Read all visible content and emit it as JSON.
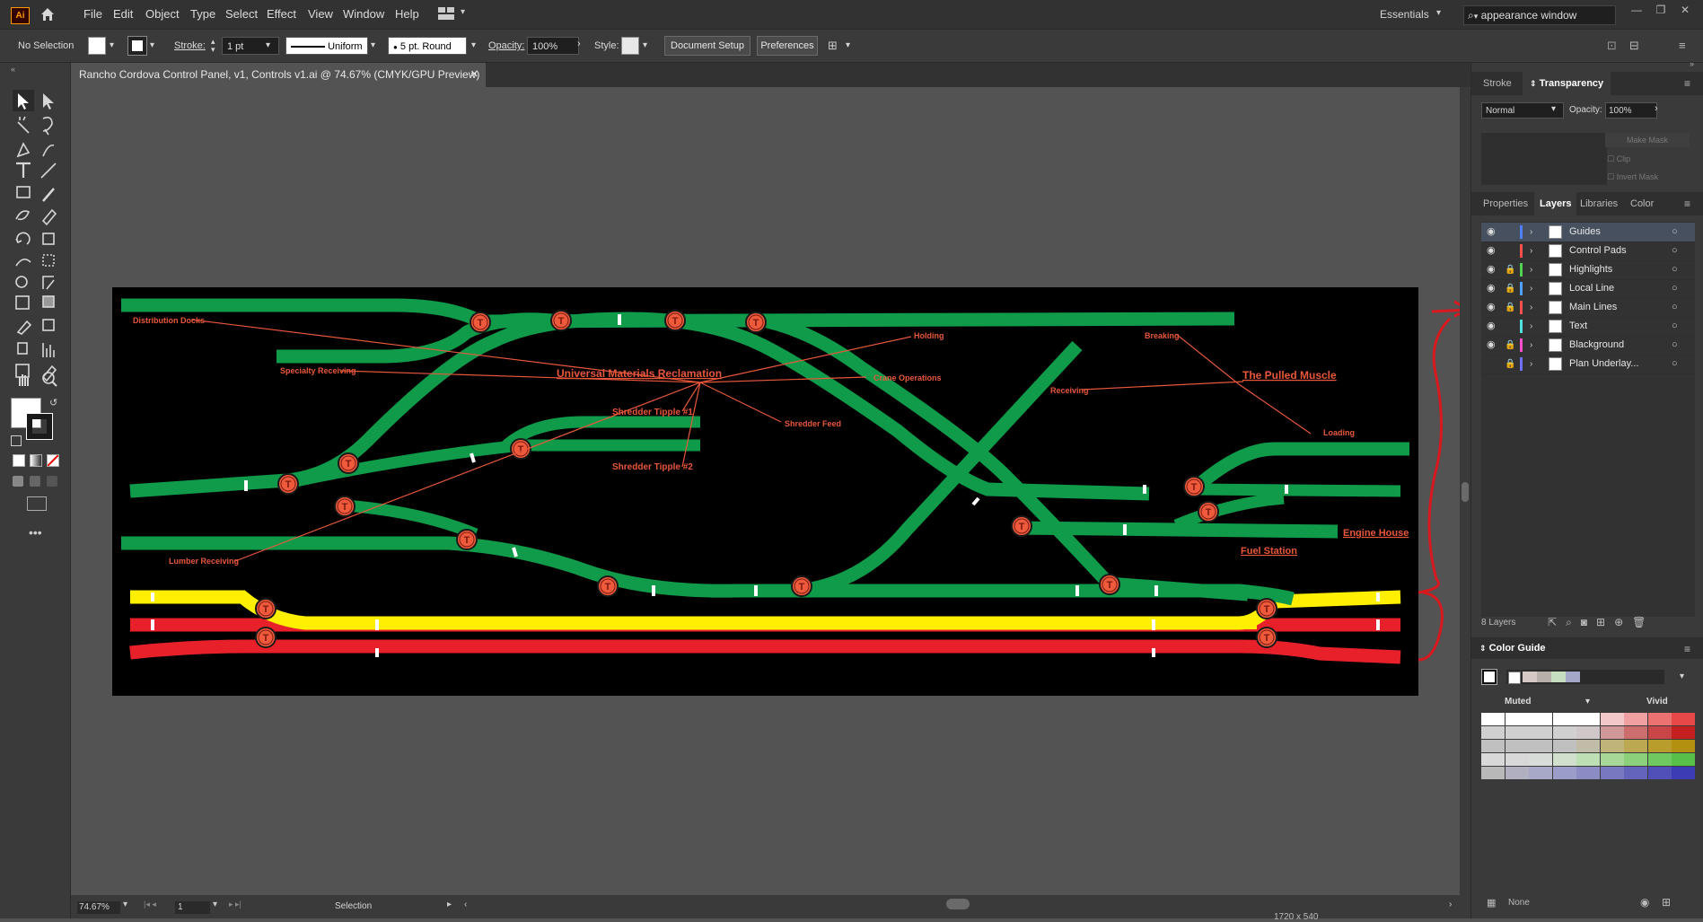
{
  "app": {
    "logo": "Ai",
    "home_icon": "home-icon"
  },
  "menu": [
    "File",
    "Edit",
    "Object",
    "Type",
    "Select",
    "Effect",
    "View",
    "Window",
    "Help"
  ],
  "workspace": "Essentials",
  "search": {
    "value": "appearance window"
  },
  "control_bar": {
    "selection": "No Selection",
    "stroke_label": "Stroke:",
    "stroke_weight": "1 pt",
    "profile": "Uniform",
    "brush": "5 pt. Round",
    "opacity_label": "Opacity:",
    "opacity": "100%",
    "style_label": "Style:",
    "document_setup": "Document Setup",
    "preferences": "Preferences"
  },
  "document": {
    "tab_title": "Rancho Cordova Control Panel, v1, Controls v1.ai @ 74.67% (CMYK/GPU Preview)"
  },
  "status": {
    "zoom": "74.67%",
    "page": "1",
    "tool": "Selection",
    "cut_readout": "1720 x 540"
  },
  "transparency_panel": {
    "tabs": [
      "Stroke",
      "Transparency"
    ],
    "blend_mode": "Normal",
    "opacity_label": "Opacity:",
    "opacity": "100%",
    "make_mask": "Make Mask",
    "clip": "Clip",
    "invert_mask": "Invert Mask"
  },
  "layers_panel": {
    "tabs": [
      "Properties",
      "Layers",
      "Libraries",
      "Color"
    ],
    "layers": [
      {
        "name": "Guides",
        "color": "#4f7fff",
        "locked": false
      },
      {
        "name": "Control Pads",
        "color": "#ff4f4f",
        "locked": false
      },
      {
        "name": "Highlights",
        "color": "#4fd24f",
        "locked": true
      },
      {
        "name": "Local Line",
        "color": "#4fa0ff",
        "locked": true
      },
      {
        "name": "Main Lines",
        "color": "#ff4f4f",
        "locked": true
      },
      {
        "name": "Text",
        "color": "#4fe0e0",
        "locked": false
      },
      {
        "name": "Blackground",
        "color": "#ff4fc8",
        "locked": true
      },
      {
        "name": "Plan Underlay...",
        "color": "#7070ff",
        "locked": true
      }
    ],
    "count": "8 Layers"
  },
  "color_guide": {
    "title": "Color Guide",
    "muted": "Muted",
    "vivid": "Vivid",
    "none_label": "None"
  },
  "diagram_labels": {
    "distribution_docks": "Distribution Docks",
    "specialty_receiving": "Specialty Receiving",
    "lumber_receiving": "Lumber Receiving",
    "umr": "Universal Materials Reclamation",
    "shredder_tipple_1": "Shredder Tipple #1",
    "shredder_tipple_2": "Shredder Tipple #2",
    "shredder_feed": "Shredder Feed",
    "crane_operations": "Crane Operations",
    "holding": "Holding",
    "breaking": "Breaking",
    "receiving": "Receiving",
    "pulled_muscle": "The Pulled Muscle",
    "loading": "Loading",
    "engine_house": "Engine House",
    "fuel_station": "Fuel Station",
    "turnout": "T"
  },
  "colors": {
    "green_track": "#0f9b4a",
    "yellow_line": "#ffef00",
    "red_line": "#e8202a",
    "label_red": "#e8573b",
    "turnout_fill": "#ef5a3c"
  }
}
